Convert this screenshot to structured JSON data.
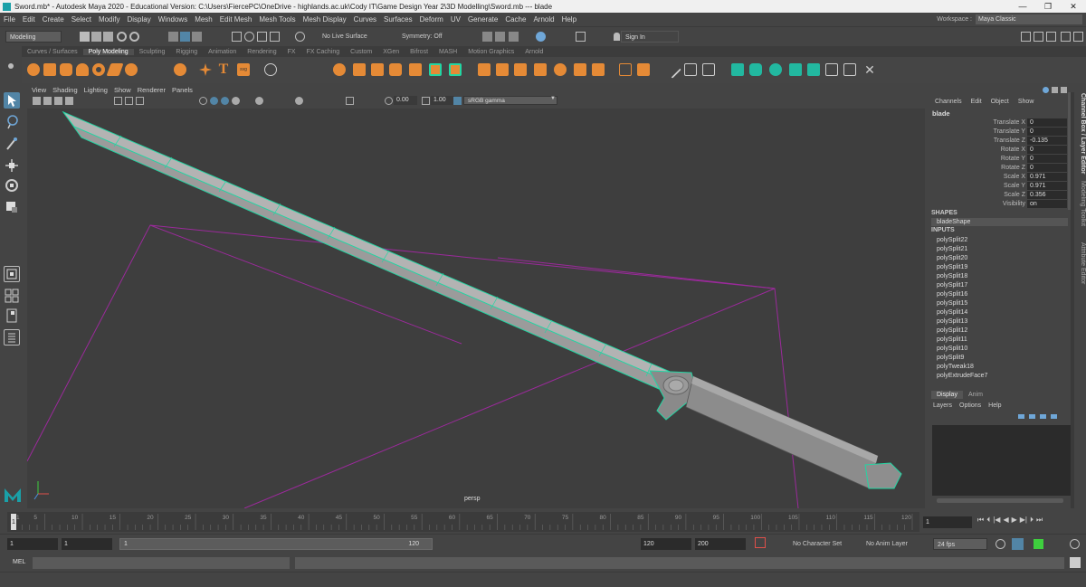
{
  "window": {
    "title": "Sword.mb* - Autodesk Maya 2020 - Educational Version: C:\\Users\\FiercePC\\OneDrive - highlands.ac.uk\\Cody IT\\Game Design Year 2\\3D Modelling\\Sword.mb  ---  blade",
    "controls": [
      "—",
      "❐",
      "✕"
    ]
  },
  "menu": [
    "File",
    "Edit",
    "Create",
    "Select",
    "Modify",
    "Display",
    "Windows",
    "Mesh",
    "Edit Mesh",
    "Mesh Tools",
    "Mesh Display",
    "Curves",
    "Surfaces",
    "Deform",
    "UV",
    "Generate",
    "Cache",
    "Arnold",
    "Help"
  ],
  "workspace": {
    "label": "Workspace :",
    "value": "Maya Classic"
  },
  "statusline": {
    "mode": "Modeling",
    "live_surface": "No Live Surface",
    "symmetry": "Symmetry: Off",
    "sign_in": "Sign In"
  },
  "shelf_tabs": [
    "Curves / Surfaces",
    "Poly Modeling",
    "Sculpting",
    "Rigging",
    "Animation",
    "Rendering",
    "FX",
    "FX Caching",
    "Custom",
    "XGen",
    "Bifrost",
    "MASH",
    "Motion Graphics",
    "Arnold"
  ],
  "shelf_active": "Poly Modeling",
  "viewport": {
    "menu": [
      "View",
      "Shading",
      "Lighting",
      "Show",
      "Renderer",
      "Panels"
    ],
    "exposure": "0.00",
    "gamma": "1.00",
    "colorspace": "sRGB gamma",
    "camera_label": "persp"
  },
  "channel_box": {
    "tabs": [
      "Channels",
      "Edit",
      "Object",
      "Show"
    ],
    "object": "blade",
    "attributes": [
      {
        "name": "Translate X",
        "value": "0"
      },
      {
        "name": "Translate Y",
        "value": "0"
      },
      {
        "name": "Translate Z",
        "value": "-0.135"
      },
      {
        "name": "Rotate X",
        "value": "0"
      },
      {
        "name": "Rotate Y",
        "value": "0"
      },
      {
        "name": "Rotate Z",
        "value": "0"
      },
      {
        "name": "Scale X",
        "value": "0.971"
      },
      {
        "name": "Scale Y",
        "value": "0.971"
      },
      {
        "name": "Scale Z",
        "value": "0.356"
      },
      {
        "name": "Visibility",
        "value": "on"
      }
    ],
    "shapes_header": "SHAPES",
    "shape": "bladeShape",
    "inputs_header": "INPUTS",
    "inputs": [
      "polySplit22",
      "polySplit21",
      "polySplit20",
      "polySplit19",
      "polySplit18",
      "polySplit17",
      "polySplit16",
      "polySplit15",
      "polySplit14",
      "polySplit13",
      "polySplit12",
      "polySplit11",
      "polySplit10",
      "polySplit9",
      "polyTweak18",
      "polyExtrudeFace7"
    ]
  },
  "side_tabs": [
    "Channel Box / Layer Editor",
    "Modeling Toolkit",
    "Attribute Editor"
  ],
  "layer_editor": {
    "tabs": [
      "Display",
      "Anim"
    ],
    "menu": [
      "Layers",
      "Options",
      "Help"
    ]
  },
  "timeline": {
    "ticks": [
      "1",
      "5",
      "10",
      "15",
      "20",
      "25",
      "30",
      "35",
      "40",
      "45",
      "50",
      "55",
      "60",
      "65",
      "70",
      "75",
      "80",
      "85",
      "90",
      "95",
      "100",
      "105",
      "110",
      "115",
      "120"
    ],
    "current_frame": "1"
  },
  "range": {
    "start": "1",
    "playback_start": "1",
    "slider_start": "1",
    "slider_end": "120",
    "playback_end": "120",
    "end": "200",
    "character_set": "No Character Set",
    "anim_layer": "No Anim Layer",
    "fps": "24 fps"
  },
  "command_line": {
    "label": "MEL"
  },
  "colors": {
    "accent_teal": "#22d6a3",
    "selection_blue": "#5285a6",
    "camera_purple": "#9b2a9b"
  }
}
